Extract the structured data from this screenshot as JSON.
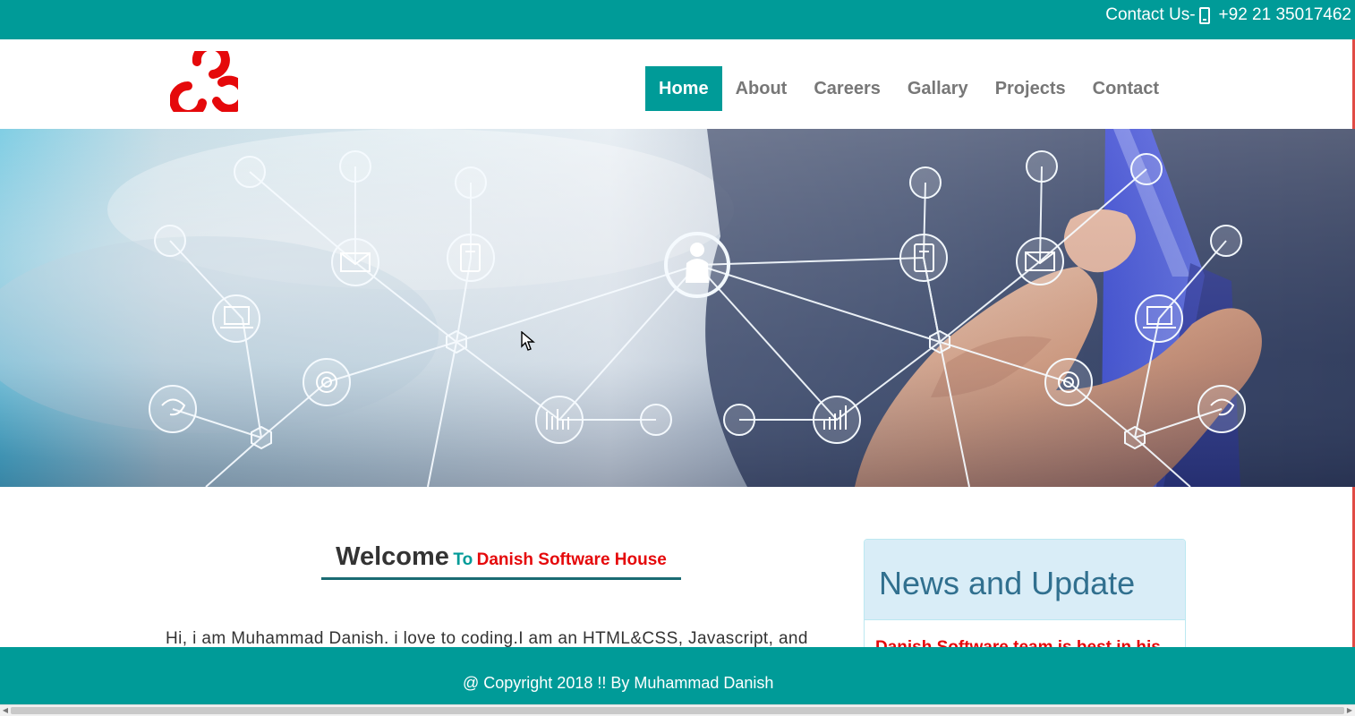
{
  "topbar": {
    "contact_label": "Contact Us-",
    "phone_icon": "mobile-phone-icon",
    "phone_number": "+92 21 35017462"
  },
  "header": {
    "logo": "red-tri-loop-logo",
    "nav": [
      {
        "label": "Home",
        "active": true
      },
      {
        "label": "About",
        "active": false
      },
      {
        "label": "Careers",
        "active": false
      },
      {
        "label": "Gallary",
        "active": false
      },
      {
        "label": "Projects",
        "active": false
      },
      {
        "label": "Contact",
        "active": false
      }
    ]
  },
  "hero": {
    "image": "network-nodes-hand-banner"
  },
  "welcome": {
    "big": "Welcome",
    "to": "To",
    "name": "Danish Software House"
  },
  "intro": {
    "text": "Hi, i am Muhammad Danish. i love to coding.I am an HTML&CSS, Javascript, and"
  },
  "news": {
    "title": "News and Update",
    "first_item": "Danish Software team is best in his"
  },
  "footer": {
    "copyright": "@ Copyright 2018 !! By Muhammad Danish"
  },
  "colors": {
    "teal": "#009b98",
    "red": "#e5090b",
    "news_bg": "#d9edf7",
    "news_text": "#31708f"
  }
}
